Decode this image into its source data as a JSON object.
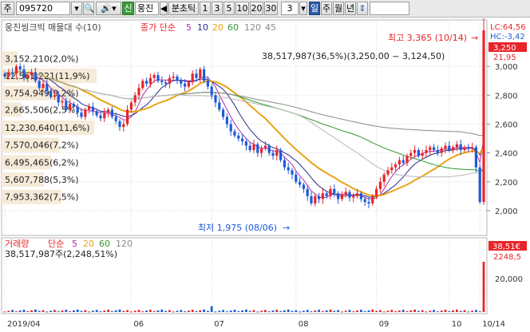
{
  "toolbar": {
    "market": "주",
    "code": "095720",
    "sound_icon": "speaker-icon",
    "credit_badge": "신",
    "stock_name": "웅진",
    "nav_prev": "◀",
    "interval_label": "분초틱",
    "intervals": [
      "1",
      "3",
      "5",
      "10",
      "20",
      "30"
    ],
    "selected_interval": "3",
    "period_tabs": [
      "일",
      "주",
      "월",
      "년"
    ],
    "selected_period": "일",
    "updown_icon": "updown-arrow-icon"
  },
  "legend": {
    "title": "웅진씽크빅 매물대 수(10)",
    "price_ma_label": "종가 단순",
    "price_ma_periods": [
      "5",
      "10",
      "20",
      "60",
      "120",
      "45"
    ],
    "volume_label": "거래량",
    "volume_ma_label": "단순",
    "volume_ma_periods": [
      "5",
      "20",
      "60",
      "120"
    ],
    "volume_summary": "38,517,987주(2,248,51%)"
  },
  "annotations": {
    "high": "최고 3,365 (10/14)",
    "high_arrow": "→",
    "low": "최저 1,975 (08/06)",
    "low_arrow": "→",
    "last_volume_bin": "38,517,987(36,5%)(3,250,00 ~ 3,124,50)"
  },
  "right_axis": {
    "lc_label": "LC:64,56",
    "hc_label": "HC:-3,42",
    "current_price": "3,250",
    "top_partial": "21,95",
    "volume_current": "38,51€",
    "volume_pct": "2248,5",
    "volume_tick": "20,000"
  },
  "colors": {
    "up": "#e8252a",
    "down": "#1e5bd6",
    "ma5": "#b02fb0",
    "ma10": "#2a2a8a",
    "ma20": "#e8a317",
    "ma60": "#2f9a2f",
    "ma120": "#8a8a8a",
    "ma45": "#b8b8b8",
    "profile": "#f6ebd8"
  },
  "chart_data": {
    "type": "candlestick",
    "price_axis": {
      "min": 1850,
      "max": 3300,
      "ticks": [
        2000,
        2200,
        2400,
        2600,
        2800,
        3000
      ]
    },
    "x_ticks": [
      {
        "label": "2019/04",
        "index": 0
      },
      {
        "label": "06",
        "index": 33
      },
      {
        "label": "07",
        "index": 54
      },
      {
        "label": "08",
        "index": 76
      },
      {
        "label": "09",
        "index": 97
      },
      {
        "label": "10",
        "index": 116
      },
      {
        "label": "10/14",
        "index": 124
      }
    ],
    "volume_profile": [
      {
        "label": "3,152,210(2,0%)",
        "price": 3055,
        "pct": 2.0
      },
      {
        "label": "12,561,221(11,9%)",
        "price": 2935,
        "pct": 11.9
      },
      {
        "label": "9,754,949(9,2%)",
        "price": 2815,
        "pct": 9.2
      },
      {
        "label": "2,665,506(2,5%)",
        "price": 2700,
        "pct": 2.5
      },
      {
        "label": "12,230,640(11,6%)",
        "price": 2575,
        "pct": 11.6
      },
      {
        "label": "7,570,046(7,2%)",
        "price": 2455,
        "pct": 7.2
      },
      {
        "label": "6,495,465(6,2%)",
        "price": 2335,
        "pct": 6.2
      },
      {
        "label": "5,607,788(5,3%)",
        "price": 2215,
        "pct": 5.3
      },
      {
        "label": "7,953,362(7,5%)",
        "price": 2095,
        "pct": 7.5
      }
    ],
    "close": [
      2930,
      2960,
      2950,
      3000,
      2980,
      2920,
      2940,
      2960,
      2900,
      2850,
      2880,
      2830,
      2790,
      2800,
      2750,
      2760,
      2700,
      2740,
      2720,
      2680,
      2650,
      2700,
      2720,
      2690,
      2660,
      2640,
      2680,
      2700,
      2650,
      2620,
      2580,
      2600,
      2700,
      2750,
      2800,
      2850,
      2900,
      2880,
      2920,
      2940,
      2900,
      2890,
      2880,
      2920,
      2930,
      2900,
      2880,
      2860,
      2890,
      2950,
      2920,
      2980,
      2900,
      2860,
      2800,
      2750,
      2700,
      2650,
      2600,
      2550,
      2520,
      2500,
      2480,
      2450,
      2420,
      2460,
      2400,
      2430,
      2450,
      2400,
      2380,
      2420,
      2350,
      2300,
      2280,
      2250,
      2200,
      2180,
      2150,
      2100,
      2050,
      2100,
      2080,
      2120,
      2100,
      2150,
      2120,
      2080,
      2110,
      2130,
      2090,
      2100,
      2120,
      2080,
      2060,
      2050,
      2100,
      2150,
      2200,
      2250,
      2280,
      2300,
      2320,
      2350,
      2330,
      2380,
      2400,
      2420,
      2380,
      2400,
      2420,
      2440,
      2420,
      2400,
      2430,
      2450,
      2420,
      2440,
      2460,
      2420,
      2440,
      2430,
      2440,
      2300,
      2060,
      3250
    ],
    "volume_max": 38517987,
    "volume_spike_index": 125
  }
}
